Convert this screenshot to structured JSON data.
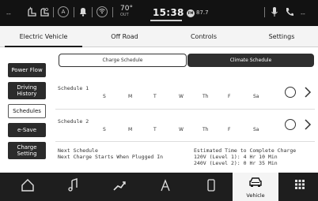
{
  "status_bar": {
    "left_dash": "--",
    "temperature": "70°",
    "temperature_label": "OUT",
    "clock": "15:38",
    "radio_badge": "FM",
    "radio_frequency": "87.7",
    "right_dash": "--",
    "icons": [
      "seat-heat-icon",
      "seat-cool-icon",
      "auto-icon",
      "bell-icon",
      "wifi-icon",
      "mic-icon",
      "phone-icon"
    ]
  },
  "top_tabs": [
    {
      "label": "Electric Vehicle",
      "active": true
    },
    {
      "label": "Off Road",
      "active": false
    },
    {
      "label": "Controls",
      "active": false
    },
    {
      "label": "Settings",
      "active": false
    }
  ],
  "sidebar": [
    {
      "label": "Power Flow",
      "active": false
    },
    {
      "label": "Driving History",
      "active": false
    },
    {
      "label": "Schedules",
      "active": true
    },
    {
      "label": "e-Save",
      "active": false
    },
    {
      "label": "Charge Setting",
      "active": false
    }
  ],
  "segmented": {
    "left": "Charge Schedule",
    "right": "Climate Schedule",
    "selected": "Climate Schedule"
  },
  "schedules": [
    {
      "label": "Schedule 1",
      "days": [
        "S",
        "M",
        "T",
        "W",
        "Th",
        "F",
        "Sa"
      ]
    },
    {
      "label": "Schedule 2",
      "days": [
        "S",
        "M",
        "T",
        "W",
        "Th",
        "F",
        "Sa"
      ]
    }
  ],
  "next_schedule": {
    "title": "Next Schedule",
    "detail": "Next Charge Starts When Plugged In"
  },
  "estimate": {
    "title": "Estimated Time to Complete Charge",
    "line1": "120V (Level 1): 4 Hr 10 Min",
    "line2": "240V (Level 2): 0 Hr 35 Min"
  },
  "dock": [
    {
      "icon": "home-icon",
      "label": ""
    },
    {
      "icon": "music-icon",
      "label": ""
    },
    {
      "icon": "climate-icon",
      "label": ""
    },
    {
      "icon": "navigation-icon",
      "label": ""
    },
    {
      "icon": "phone-device-icon",
      "label": ""
    },
    {
      "icon": "vehicle-icon",
      "label": "Vehicle",
      "active": true
    },
    {
      "icon": "apps-grid-icon",
      "label": ""
    }
  ]
}
